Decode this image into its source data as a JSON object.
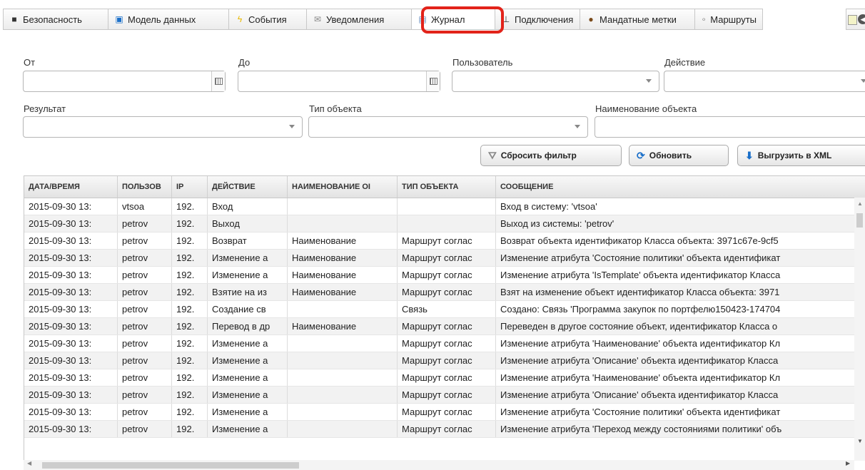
{
  "tabs": [
    {
      "label": "Безопасность",
      "icon": "security-icon",
      "ic": "■"
    },
    {
      "label": "Модель данных",
      "icon": "data-model-icon",
      "ic": "▣"
    },
    {
      "label": "События",
      "icon": "events-lightning-icon",
      "ic": "ϟ"
    },
    {
      "label": "Уведомления",
      "icon": "envelope-icon",
      "ic": "✉"
    },
    {
      "label": "Журнал",
      "icon": "journal-document-icon",
      "ic": "▤"
    },
    {
      "label": "Подключения",
      "icon": "connection-icon",
      "ic": "⊥"
    },
    {
      "label": "Мандатные метки",
      "icon": "mandatory-labels-icon",
      "ic": "●"
    },
    {
      "label": "Маршруты",
      "icon": "routes-icon",
      "ic": "∘"
    }
  ],
  "filters": {
    "from_label": "От",
    "to_label": "До",
    "user_label": "Пользователь",
    "action_label": "Действие",
    "result_label": "Результат",
    "object_type_label": "Тип объекта",
    "object_name_label": "Наименование объекта"
  },
  "buttons": {
    "reset": "Сбросить фильтр",
    "refresh": "Обновить",
    "export": "Выгрузить в XML"
  },
  "table": {
    "columns": [
      "ДАТА/ВРЕМЯ",
      "ПОЛЬЗОВ",
      "IP",
      "ДЕЙСТВИЕ",
      "НАИМЕНОВАНИЕ ОІ",
      "ТИП ОБЪЕКТА",
      "СООБЩЕНИЕ"
    ],
    "rows": [
      [
        "2015-09-30 13:",
        "vtsoa",
        "192.",
        "Вход",
        "",
        "",
        "Вход в систему: 'vtsoa'"
      ],
      [
        "2015-09-30 13:",
        "petrov",
        "192.",
        "Выход",
        "",
        "",
        "Выход из системы: 'petrov'"
      ],
      [
        "2015-09-30 13:",
        "petrov",
        "192.",
        "Возврат",
        "Наименование",
        "Маршрут соглас",
        "Возврат объекта идентификатор Класса объекта: 3971c67e-9cf5"
      ],
      [
        "2015-09-30 13:",
        "petrov",
        "192.",
        "Изменение а",
        "Наименование",
        "Маршрут соглас",
        "Изменение атрибута 'Состояние политики' объекта идентификат"
      ],
      [
        "2015-09-30 13:",
        "petrov",
        "192.",
        "Изменение а",
        "Наименование",
        "Маршрут соглас",
        "Изменение атрибута 'IsTemplate' объекта идентификатор Класса"
      ],
      [
        "2015-09-30 13:",
        "petrov",
        "192.",
        "Взятие на из",
        "Наименование",
        "Маршрут соглас",
        "Взят на изменение объект идентификатор Класса объекта: 3971"
      ],
      [
        "2015-09-30 13:",
        "petrov",
        "192.",
        "Создание св",
        "",
        "Связь",
        "Создано: Связь 'Программа закупок по портфелю150423-174704"
      ],
      [
        "2015-09-30 13:",
        "petrov",
        "192.",
        "Перевод в др",
        "Наименование",
        "Маршрут соглас",
        "Переведен в другое состояние объект, идентификатор Класса о"
      ],
      [
        "2015-09-30 13:",
        "petrov",
        "192.",
        "Изменение а",
        "",
        "Маршрут соглас",
        "Изменение атрибута 'Наименование' объекта идентификатор Кл"
      ],
      [
        "2015-09-30 13:",
        "petrov",
        "192.",
        "Изменение а",
        "",
        "Маршрут соглас",
        "Изменение атрибута 'Описание' объекта идентификатор Класса"
      ],
      [
        "2015-09-30 13:",
        "petrov",
        "192.",
        "Изменение а",
        "",
        "Маршрут соглас",
        "Изменение атрибута 'Наименование' объекта идентификатор Кл"
      ],
      [
        "2015-09-30 13:",
        "petrov",
        "192.",
        "Изменение а",
        "",
        "Маршрут соглас",
        "Изменение атрибута 'Описание' объекта идентификатор Класса"
      ],
      [
        "2015-09-30 13:",
        "petrov",
        "192.",
        "Изменение а",
        "",
        "Маршрут соглас",
        "Изменение атрибута 'Состояние политики' объекта идентификат"
      ],
      [
        "2015-09-30 13:",
        "petrov",
        "192.",
        "Изменение а",
        "",
        "Маршрут соглас",
        "Изменение атрибута 'Переход между состояниями политики' объ"
      ]
    ]
  },
  "colors": {
    "highlight": "#e2231a"
  }
}
